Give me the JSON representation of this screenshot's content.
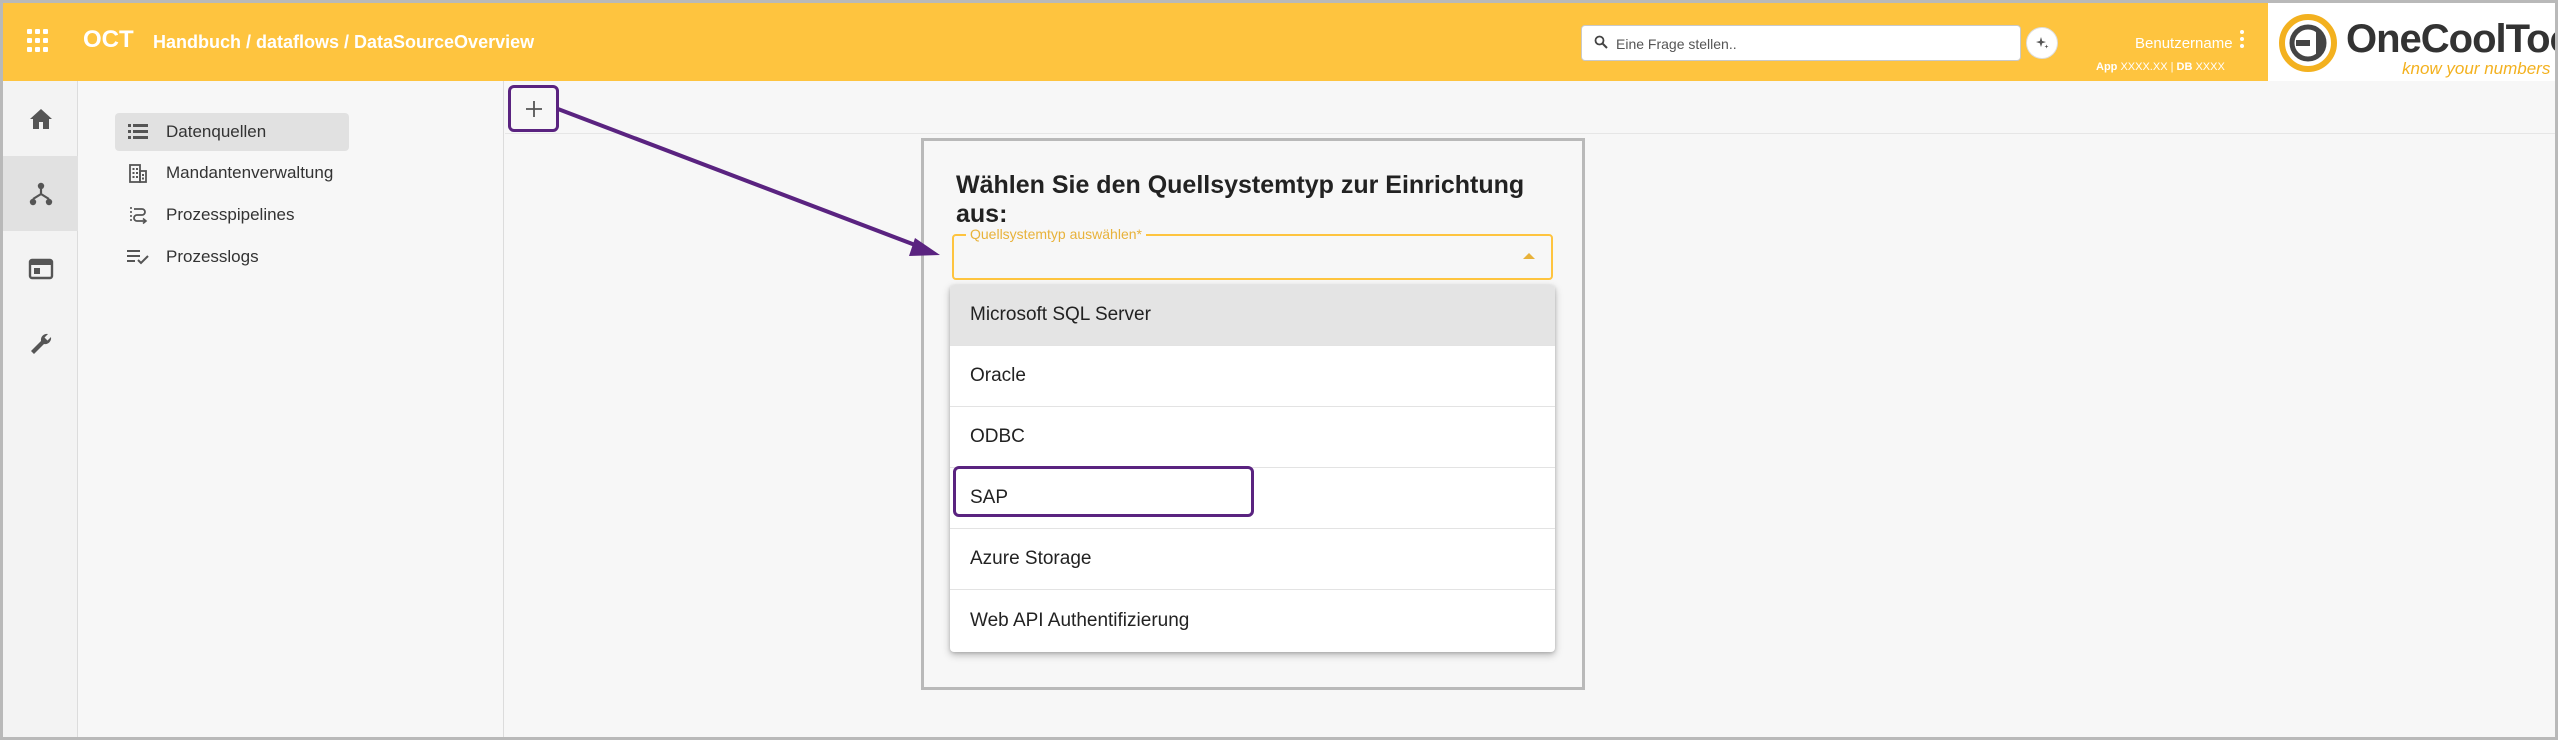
{
  "topbar": {
    "brand": "OCT",
    "breadcrumb": "Handbuch / dataflows / DataSourceOverview",
    "search_placeholder": "Eine Frage stellen..",
    "user_name": "Benutzername",
    "version_app_label": "App",
    "version_app": "XXXX.XX",
    "version_sep": "|",
    "version_db_label": "DB",
    "version_db": "XXXX",
    "logo_name": "OneCoolTool",
    "logo_tagline": "know your numbers"
  },
  "rail": {
    "items": [
      {
        "icon": "home-icon",
        "active": false
      },
      {
        "icon": "dataflow-icon",
        "active": true
      },
      {
        "icon": "dashboard-icon",
        "active": false
      },
      {
        "icon": "wrench-icon",
        "active": false
      }
    ]
  },
  "nav": {
    "items": [
      {
        "label": "Datenquellen",
        "icon": "list-icon",
        "active": true
      },
      {
        "label": "Mandantenverwaltung",
        "icon": "building-icon",
        "active": false
      },
      {
        "label": "Prozesspipelines",
        "icon": "pipeline-icon",
        "active": false
      },
      {
        "label": "Prozesslogs",
        "icon": "checklist-icon",
        "active": false
      }
    ]
  },
  "dialog": {
    "title": "Wählen Sie den Quellsystemtyp zur Einrichtung aus:",
    "select_label": "Quellsystemtyp auswählen*",
    "options": [
      "Microsoft SQL Server",
      "Oracle",
      "ODBC",
      "SAP",
      "Azure Storage",
      "Web API Authentifizierung"
    ],
    "hovered_option_index": 0,
    "highlighted_option_index": 3
  },
  "colors": {
    "accent": "#fec43f",
    "annotation": "#5a2380",
    "logo_ring": "#f3b11f"
  }
}
